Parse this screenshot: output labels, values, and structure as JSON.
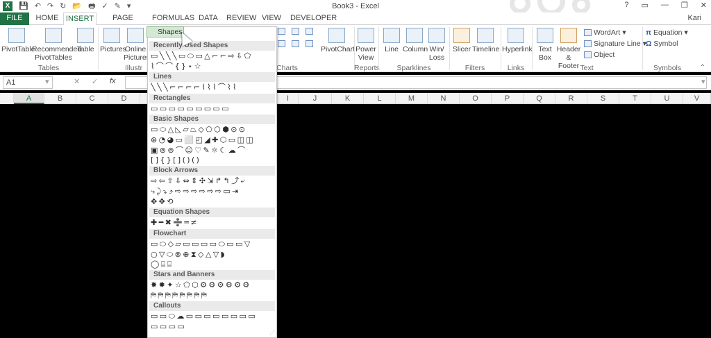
{
  "window": {
    "title": "Book3 - Excel",
    "user": "Kari",
    "help": "?",
    "restore": "▭",
    "minimize": "—",
    "maximize": "❐",
    "close": "✕"
  },
  "qat": {
    "save": "💾",
    "undo": "↶",
    "redo": "↷",
    "refresh": "↻",
    "open": "📂",
    "print": "🖶",
    "spell": "✓",
    "brush": "✎",
    "more": "▾"
  },
  "tabs": [
    "FILE",
    "HOME",
    "INSERT",
    "PAGE LAYOUT",
    "FORMULAS",
    "DATA",
    "REVIEW",
    "VIEW",
    "DEVELOPER"
  ],
  "ribbon": {
    "pivottable": "PivotTable",
    "recommended1": "Recommended",
    "recommended2": "PivotTables",
    "table": "Table",
    "pictures": "Pictures",
    "online1": "Online",
    "online2": "Pictures",
    "shapes": "Shapes",
    "pivotchart": "PivotChart",
    "powerview1": "Power",
    "powerview2": "View",
    "line": "Line",
    "column": "Column",
    "winloss1": "Win/",
    "winloss2": "Loss",
    "slicer": "Slicer",
    "timeline": "Timeline",
    "hyperlink": "Hyperlink",
    "textbox1": "Text",
    "textbox2": "Box",
    "header1": "Header",
    "header2": "& Footer",
    "wordart": "WordArt",
    "signature": "Signature Line",
    "object": "Object",
    "equation": "Equation",
    "symbol": "Symbol",
    "dropdown": "▾"
  },
  "groups": {
    "tables": "Tables",
    "illustrations": "Illustr",
    "charts": "Charts",
    "reports": "Reports",
    "sparklines": "Sparklines",
    "filters": "Filters",
    "links": "Links",
    "text": "Text",
    "symbols": "Symbols"
  },
  "formula_bar": {
    "name_box": "A1",
    "cancel": "✕",
    "enter": "✓",
    "fx": "fx",
    "formula": ""
  },
  "columns": [
    "A",
    "B",
    "C",
    "D",
    "I",
    "J",
    "K",
    "L",
    "M",
    "N",
    "O",
    "P",
    "Q",
    "R",
    "S",
    "T",
    "U",
    "V"
  ],
  "gallery": {
    "sections": [
      {
        "title": "Recently Used Shapes",
        "rows": [
          "▭╲╲╲▭⬭▭△⌐⌐⇨⇩⬠",
          "⌇⌒⌒{}⋆☆"
        ]
      },
      {
        "title": "Lines",
        "rows": [
          "╲╲╲⌐⌐⌐⌐⌇⌇⌇⌒⌇⌇"
        ]
      },
      {
        "title": "Rectangles",
        "rows": [
          "▭▭▭▭▭▭▭▭▭"
        ]
      },
      {
        "title": "Basic Shapes",
        "rows": [
          "▭⬭△◺▱⏢◇⬠⬡⬢⊙⊙",
          "⊛◔◕▭⬜◰◢✚⬡▭◫◫",
          "▣⊚⊚⌒☺♡✎☼☾☁⌒",
          "[]{}[]()()"
        ]
      },
      {
        "title": "Block Arrows",
        "rows": [
          "⇨⇦⇧⇩⇔⇕✣⇲↱↰⤴⤶",
          "⤷⤸⤵⤴⇨⇨⇨⇨⇨⇨▭⇥",
          "✥✥⟲"
        ]
      },
      {
        "title": "Equation Shapes",
        "rows": [
          "✚━✖➗═≠"
        ]
      },
      {
        "title": "Flowchart",
        "rows": [
          "▭⬭◇▱▭▭▭▭⬭▭▭▽",
          "○▽⬭⊗⊕⧗◇△▽◗",
          "◯⌸⌸"
        ]
      },
      {
        "title": "Stars and Banners",
        "rows": [
          "✸✹✦☆⬠⬡⚙⚙⚙⚙⚙⚙",
          "⛿⛿⛿⛿⛿⛿⛿⛿"
        ]
      },
      {
        "title": "Callouts",
        "rows": [
          "▭▭⬭☁▭▭▭▭▭▭▭▭",
          "▭▭▭▭"
        ]
      }
    ]
  }
}
